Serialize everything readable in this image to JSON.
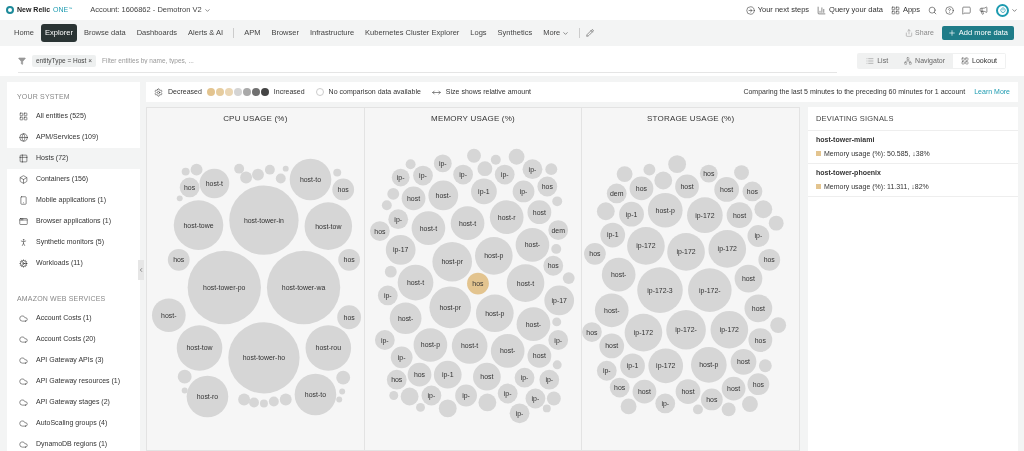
{
  "header": {
    "brand": "New Relic",
    "product": "ONE",
    "mark": "™",
    "account": "Account: 1606862 - Demotron V2",
    "actions": [
      {
        "label": "Your next steps",
        "kind": "steps"
      },
      {
        "label": "Query your data",
        "kind": "query"
      },
      {
        "label": "Apps",
        "kind": "apps"
      }
    ]
  },
  "nav": {
    "primary": [
      {
        "label": "Home",
        "selected": false
      },
      {
        "label": "Explorer",
        "selected": true
      },
      {
        "label": "Browse data",
        "selected": false
      },
      {
        "label": "Dashboards",
        "selected": false
      },
      {
        "label": "Alerts & AI",
        "selected": false
      }
    ],
    "products": [
      {
        "label": "APM",
        "selected": false
      },
      {
        "label": "Browser",
        "selected": false
      },
      {
        "label": "Infrastructure",
        "selected": false
      },
      {
        "label": "Kubernetes Cluster Explorer",
        "selected": false
      },
      {
        "label": "Logs",
        "selected": false
      },
      {
        "label": "Synthetics",
        "selected": false
      }
    ],
    "more": "More",
    "share": "Share",
    "add_data": "Add more data"
  },
  "filter": {
    "chip": {
      "key": "entityType",
      "op": "=",
      "value": "Host",
      "remove": "×"
    },
    "placeholder": "Filter entities by name, types, ...",
    "views": [
      {
        "label": "List",
        "kind": "list",
        "selected": false
      },
      {
        "label": "Navigator",
        "kind": "navigator",
        "selected": false
      },
      {
        "label": "Lookout",
        "kind": "lookout",
        "selected": true
      }
    ]
  },
  "sidebar": [
    {
      "title": "YOUR SYSTEM",
      "items": [
        {
          "label": "All entities (525)",
          "kind": "all",
          "selected": false
        },
        {
          "label": "APM/Services (109)",
          "kind": "apm",
          "selected": false
        },
        {
          "label": "Hosts (72)",
          "kind": "hosts",
          "selected": true
        },
        {
          "label": "Containers (156)",
          "kind": "containers",
          "selected": false
        },
        {
          "label": "Mobile applications (1)",
          "kind": "mobile",
          "selected": false
        },
        {
          "label": "Browser applications (1)",
          "kind": "browser",
          "selected": false
        },
        {
          "label": "Synthetic monitors (5)",
          "kind": "synthetic",
          "selected": false
        },
        {
          "label": "Workloads (11)",
          "kind": "workloads",
          "selected": false
        }
      ]
    },
    {
      "title": "AMAZON WEB SERVICES",
      "items": [
        {
          "label": "Account Costs (1)",
          "kind": "cloud",
          "selected": false
        },
        {
          "label": "Account Costs (20)",
          "kind": "cloud",
          "selected": false
        },
        {
          "label": "API Gateway APIs (3)",
          "kind": "cloud",
          "selected": false
        },
        {
          "label": "API Gateway resources (1)",
          "kind": "cloud",
          "selected": false
        },
        {
          "label": "API Gateway stages (2)",
          "kind": "cloud",
          "selected": false
        },
        {
          "label": "AutoScaling groups (4)",
          "kind": "cloud",
          "selected": false
        },
        {
          "label": "DynamoDB regions (1)",
          "kind": "cloud",
          "selected": false
        }
      ]
    }
  ],
  "legend": {
    "decreased": "Decreased",
    "increased": "Increased",
    "steps": [
      {
        "color": "#e3c48f"
      },
      {
        "color": "#e6cc9e"
      },
      {
        "color": "#ead6b4"
      },
      {
        "color": "#d4d4d4"
      },
      {
        "color": "#a9a9a9"
      },
      {
        "color": "#707070"
      },
      {
        "color": "#444444"
      }
    ],
    "no_data": "No comparison data available",
    "size_note": "Size shows relative amount",
    "comparison": "Comparing the last 5 minutes to the preceding 60 minutes for 1 account",
    "learn_more": "Learn More"
  },
  "charts": [
    {
      "title": "CPU USAGE (%)",
      "bubbles": [
        {
          "label": "host-t",
          "color": "#d6d6d6"
        },
        {
          "label": "hos",
          "color": "#d6d6d6"
        },
        {
          "label": "host-to",
          "color": "#d6d6d6"
        },
        {
          "label": "hos",
          "color": "#d6d6d6"
        },
        {
          "label": "host-towe",
          "color": "#d6d6d6"
        },
        {
          "label": "host-tower-in",
          "color": "#d6d6d6"
        },
        {
          "label": "host-tow",
          "color": "#d6d6d6"
        },
        {
          "label": "hos",
          "color": "#d6d6d6"
        },
        {
          "label": "hos",
          "color": "#d6d6d6"
        },
        {
          "label": "host-tower-po",
          "color": "#d6d6d6"
        },
        {
          "label": "host-tower-wa",
          "color": "#d6d6d6"
        },
        {
          "label": "host-",
          "color": "#d6d6d6"
        },
        {
          "label": "hos",
          "color": "#d6d6d6"
        },
        {
          "label": "host-tow",
          "color": "#d6d6d6"
        },
        {
          "label": "host-tower-ho",
          "color": "#d6d6d6"
        },
        {
          "label": "host-rou",
          "color": "#d6d6d6"
        },
        {
          "label": "host-ro",
          "color": "#d6d6d6"
        },
        {
          "label": "host-to",
          "color": "#d6d6d6"
        }
      ]
    },
    {
      "title": "MEMORY USAGE (%)",
      "bubbles": [
        {
          "label": "ip-",
          "color": "#d6d6d6"
        },
        {
          "label": "ip-",
          "color": "#d6d6d6"
        },
        {
          "label": "ip-",
          "color": "#d6d6d6"
        },
        {
          "label": "ip-",
          "color": "#d6d6d6"
        },
        {
          "label": "ip-",
          "color": "#d6d6d6"
        },
        {
          "label": "ip-",
          "color": "#d6d6d6"
        },
        {
          "label": "host",
          "color": "#d6d6d6"
        },
        {
          "label": "host-",
          "color": "#d6d6d6"
        },
        {
          "label": "ip-1",
          "color": "#d6d6d6"
        },
        {
          "label": "ip-",
          "color": "#d6d6d6"
        },
        {
          "label": "hos",
          "color": "#d6d6d6"
        },
        {
          "label": "ip-",
          "color": "#d6d6d6"
        },
        {
          "label": "host-t",
          "color": "#d6d6d6"
        },
        {
          "label": "host-t",
          "color": "#d6d6d6"
        },
        {
          "label": "host-r",
          "color": "#d6d6d6"
        },
        {
          "label": "host",
          "color": "#d6d6d6"
        },
        {
          "label": "hos",
          "color": "#d6d6d6"
        },
        {
          "label": "dem",
          "color": "#d6d6d6"
        },
        {
          "label": "ip-17",
          "color": "#d6d6d6"
        },
        {
          "label": "host-pr",
          "color": "#d6d6d6"
        },
        {
          "label": "host-p",
          "color": "#d6d6d6"
        },
        {
          "label": "host-",
          "color": "#d6d6d6"
        },
        {
          "label": "hos",
          "color": "#d6d6d6"
        },
        {
          "label": "host-t",
          "color": "#d6d6d6"
        },
        {
          "label": "hos",
          "color": "#e3c48f"
        },
        {
          "label": "host-t",
          "color": "#d6d6d6"
        },
        {
          "label": "ip-",
          "color": "#d6d6d6"
        },
        {
          "label": "ip-17",
          "color": "#d6d6d6"
        },
        {
          "label": "host-pr",
          "color": "#d6d6d6"
        },
        {
          "label": "host-p",
          "color": "#d6d6d6"
        },
        {
          "label": "host-",
          "color": "#d6d6d6"
        },
        {
          "label": "host-",
          "color": "#d6d6d6"
        },
        {
          "label": "ip-",
          "color": "#d6d6d6"
        },
        {
          "label": "host-p",
          "color": "#d6d6d6"
        },
        {
          "label": "host-t",
          "color": "#d6d6d6"
        },
        {
          "label": "host-",
          "color": "#d6d6d6"
        },
        {
          "label": "ip-",
          "color": "#d6d6d6"
        },
        {
          "label": "ip-",
          "color": "#d6d6d6"
        },
        {
          "label": "host",
          "color": "#d6d6d6"
        },
        {
          "label": "hos",
          "color": "#d6d6d6"
        },
        {
          "label": "hos",
          "color": "#d6d6d6"
        },
        {
          "label": "ip-1",
          "color": "#d6d6d6"
        },
        {
          "label": "host",
          "color": "#d6d6d6"
        },
        {
          "label": "ip-",
          "color": "#d6d6d6"
        },
        {
          "label": "ip-",
          "color": "#d6d6d6"
        },
        {
          "label": "ip-",
          "color": "#d6d6d6"
        },
        {
          "label": "ip-",
          "color": "#d6d6d6"
        },
        {
          "label": "ip-",
          "color": "#d6d6d6"
        },
        {
          "label": "ip-",
          "color": "#d6d6d6"
        },
        {
          "label": "ip-",
          "color": "#d6d6d6"
        }
      ]
    },
    {
      "title": "STORAGE USAGE (%)",
      "bubbles": [
        {
          "label": "hos",
          "color": "#d6d6d6"
        },
        {
          "label": "dem",
          "color": "#d6d6d6"
        },
        {
          "label": "hos",
          "color": "#d6d6d6"
        },
        {
          "label": "host",
          "color": "#d6d6d6"
        },
        {
          "label": "host",
          "color": "#d6d6d6"
        },
        {
          "label": "hos",
          "color": "#d6d6d6"
        },
        {
          "label": "ip-1",
          "color": "#d6d6d6"
        },
        {
          "label": "host-p",
          "color": "#d6d6d6"
        },
        {
          "label": "ip-172",
          "color": "#d6d6d6"
        },
        {
          "label": "host",
          "color": "#d6d6d6"
        },
        {
          "label": "ip-1",
          "color": "#d6d6d6"
        },
        {
          "label": "ip-",
          "color": "#d6d6d6"
        },
        {
          "label": "ip-172",
          "color": "#d6d6d6"
        },
        {
          "label": "ip-172",
          "color": "#d6d6d6"
        },
        {
          "label": "ip-172",
          "color": "#d6d6d6"
        },
        {
          "label": "hos",
          "color": "#d6d6d6"
        },
        {
          "label": "hos",
          "color": "#d6d6d6"
        },
        {
          "label": "host-",
          "color": "#d6d6d6"
        },
        {
          "label": "ip-172-3",
          "color": "#d6d6d6"
        },
        {
          "label": "ip-172-",
          "color": "#d6d6d6"
        },
        {
          "label": "host",
          "color": "#d6d6d6"
        },
        {
          "label": "host-",
          "color": "#d6d6d6"
        },
        {
          "label": "host",
          "color": "#d6d6d6"
        },
        {
          "label": "hos",
          "color": "#d6d6d6"
        },
        {
          "label": "ip-172",
          "color": "#d6d6d6"
        },
        {
          "label": "ip-172-",
          "color": "#d6d6d6"
        },
        {
          "label": "ip-172",
          "color": "#d6d6d6"
        },
        {
          "label": "hos",
          "color": "#d6d6d6"
        },
        {
          "label": "host",
          "color": "#d6d6d6"
        },
        {
          "label": "ip-",
          "color": "#d6d6d6"
        },
        {
          "label": "ip-1",
          "color": "#d6d6d6"
        },
        {
          "label": "ip-172",
          "color": "#d6d6d6"
        },
        {
          "label": "host-p",
          "color": "#d6d6d6"
        },
        {
          "label": "host",
          "color": "#d6d6d6"
        },
        {
          "label": "hos",
          "color": "#d6d6d6"
        },
        {
          "label": "host",
          "color": "#d6d6d6"
        },
        {
          "label": "host",
          "color": "#d6d6d6"
        },
        {
          "label": "host",
          "color": "#d6d6d6"
        },
        {
          "label": "hos",
          "color": "#d6d6d6"
        },
        {
          "label": "ip-",
          "color": "#d6d6d6"
        },
        {
          "label": "hos",
          "color": "#d6d6d6"
        }
      ]
    }
  ],
  "deviating": {
    "title": "DEVIATING SIGNALS",
    "signals": [
      {
        "entity": "host-tower-miami",
        "text": "Memory usage (%): 50.585, ↓38%",
        "color": "#e3c48f"
      },
      {
        "entity": "host-tower-phoenix",
        "text": "Memory usage (%): 11.311, ↓82%",
        "color": "#e3c48f"
      }
    ]
  }
}
